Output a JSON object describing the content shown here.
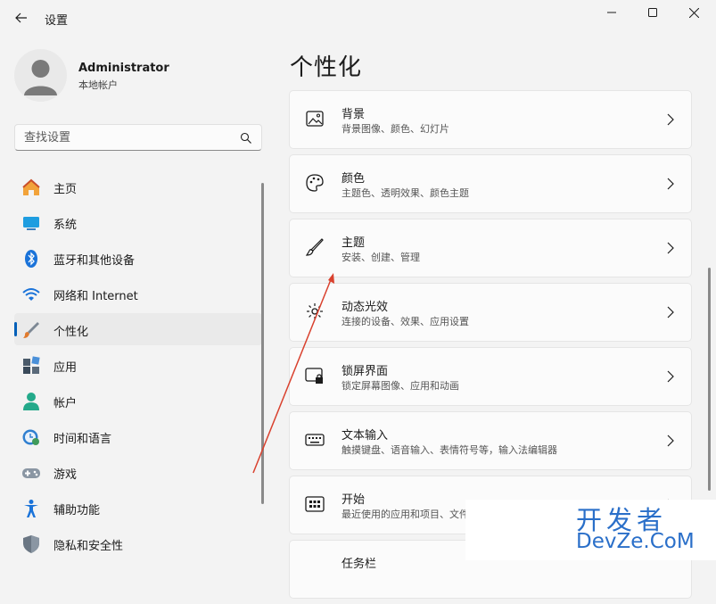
{
  "window": {
    "title": "设置"
  },
  "profile": {
    "name": "Administrator",
    "account_type": "本地帐户"
  },
  "search": {
    "placeholder": "查找设置"
  },
  "sidebar": {
    "items": [
      {
        "label": "主页",
        "icon": "home-icon"
      },
      {
        "label": "系统",
        "icon": "system-icon"
      },
      {
        "label": "蓝牙和其他设备",
        "icon": "bluetooth-icon"
      },
      {
        "label": "网络和 Internet",
        "icon": "wifi-icon"
      },
      {
        "label": "个性化",
        "icon": "brush-icon",
        "selected": true
      },
      {
        "label": "应用",
        "icon": "apps-icon"
      },
      {
        "label": "帐户",
        "icon": "account-icon"
      },
      {
        "label": "时间和语言",
        "icon": "time-language-icon"
      },
      {
        "label": "游戏",
        "icon": "gamepad-icon"
      },
      {
        "label": "辅助功能",
        "icon": "accessibility-icon"
      },
      {
        "label": "隐私和安全性",
        "icon": "shield-icon"
      }
    ]
  },
  "main": {
    "title": "个性化",
    "cards": [
      {
        "title": "背景",
        "description": "背景图像、颜色、幻灯片",
        "icon": "image-icon"
      },
      {
        "title": "颜色",
        "description": "主题色、透明效果、颜色主题",
        "icon": "palette-icon"
      },
      {
        "title": "主题",
        "description": "安装、创建、管理",
        "icon": "brush-icon"
      },
      {
        "title": "动态光效",
        "description": "连接的设备、效果、应用设置",
        "icon": "dynamic-lighting-icon"
      },
      {
        "title": "锁屏界面",
        "description": "锁定屏幕图像、应用和动画",
        "icon": "lock-screen-icon"
      },
      {
        "title": "文本输入",
        "description": "触摸键盘、语音输入、表情符号等，输入法编辑器",
        "icon": "keyboard-icon"
      },
      {
        "title": "开始",
        "description": "最近使用的应用和项目、文件",
        "icon": "start-icon"
      },
      {
        "title": "任务栏",
        "description": "",
        "icon": "taskbar-icon"
      }
    ]
  },
  "watermark": {
    "line1": "开发者",
    "line2": "DevZe.CoM"
  },
  "colors": {
    "accent": "#005fb8",
    "annotation": "#d9412e",
    "watermark": "#2a6fc9"
  }
}
